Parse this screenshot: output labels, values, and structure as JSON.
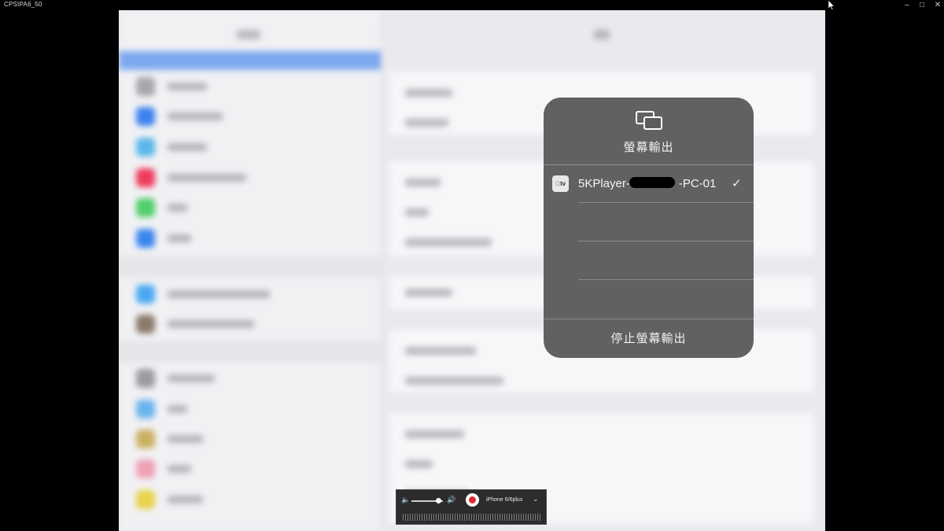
{
  "window": {
    "title": "CPSIPA6_50",
    "controls": {
      "minimize": "–",
      "maximize": "□",
      "close": "✕"
    }
  },
  "mirroring_panel": {
    "title": "螢幕輸出",
    "device": {
      "name": "5KPlayer-",
      "name_suffix": "-PC-01",
      "device_icon_label": "tv",
      "checkmark": "✓",
      "selected": true
    },
    "stop_label": "停止螢幕輸出"
  },
  "recorder_toolbar": {
    "volume_low_icon": "🔈",
    "volume_level": 0.85,
    "volume_high_icon": "🔊",
    "record_button": "record-icon",
    "device_model": "iPhone 6/6plus",
    "dropdown_icon": "⌄"
  },
  "colors": {
    "panel_background": "#5c5c5f",
    "record_red": "#e0282b",
    "ipad_background": "#e9e9ee"
  }
}
